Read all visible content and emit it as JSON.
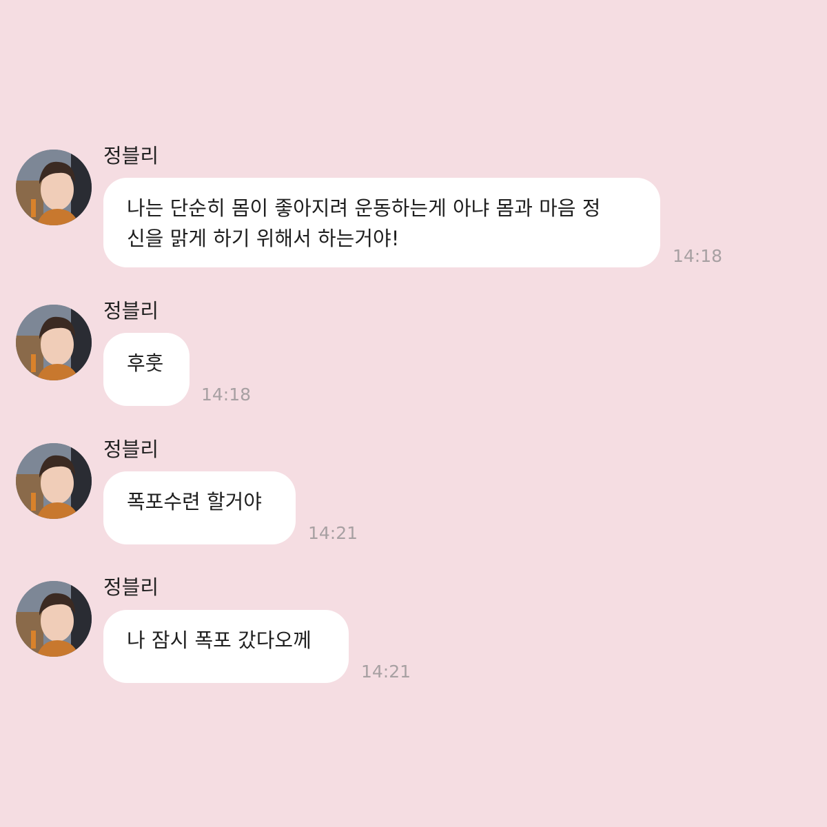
{
  "theme": {
    "background": "#f5dde2",
    "bubble": "#ffffff",
    "text": "#1e1e1e",
    "timestamp": "#a7a0a2"
  },
  "messages": [
    {
      "sender": "정블리",
      "avatar_icon": "profile-photo",
      "lines": [
        "나는 단순히 몸이 좋아지려 운동하는게 아냐 몸과 마음 정",
        "신을 맑게 하기 위해서 하는거야!"
      ],
      "time": "14:18"
    },
    {
      "sender": "정블리",
      "avatar_icon": "profile-photo",
      "lines": [
        "후훗"
      ],
      "time": "14:18"
    },
    {
      "sender": "정블리",
      "avatar_icon": "profile-photo",
      "lines": [
        "폭포수련 할거야"
      ],
      "time": "14:21"
    },
    {
      "sender": "정블리",
      "avatar_icon": "profile-photo",
      "lines": [
        "나 잠시 폭포 갔다오께"
      ],
      "time": "14:21"
    }
  ]
}
